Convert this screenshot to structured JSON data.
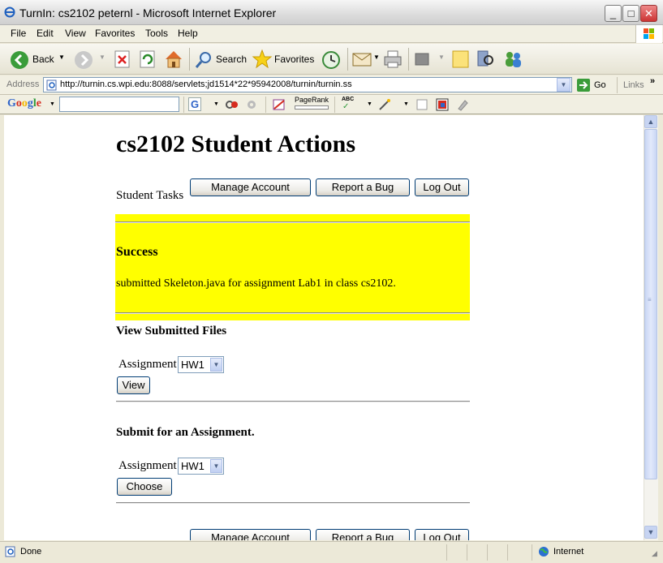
{
  "window": {
    "title": "TurnIn: cs2102 peternl - Microsoft Internet Explorer",
    "minimize": "_",
    "maximize": "□",
    "close": "✕"
  },
  "menu": [
    "File",
    "Edit",
    "View",
    "Favorites",
    "Tools",
    "Help"
  ],
  "toolbar": {
    "back": "Back",
    "search": "Search",
    "favorites": "Favorites"
  },
  "address": {
    "label": "Address",
    "url": "http://turnin.cs.wpi.edu:8088/servlets;jd1514*22*95942008/turnin/turnin.ss",
    "go": "Go",
    "links": "Links"
  },
  "google": {
    "logo": "Google",
    "g_label": "G",
    "pagerank": "PageRank",
    "abc": "ABC"
  },
  "page": {
    "heading": "cs2102 Student Actions",
    "student_tasks": "Student Tasks",
    "manage_account": "Manage Account",
    "report_bug": "Report a Bug",
    "log_out": "Log Out",
    "success_title": "Success",
    "success_message": "submitted Skeleton.java for assignment Lab1 in class cs2102.",
    "view_title": "View Submitted Files",
    "assignment_label": "Assignment",
    "view_select_value": "HW1",
    "view_button": "View",
    "submit_title": "Submit for an Assignment.",
    "submit_assignment_label": "Assignment",
    "submit_select_value": "HW1",
    "choose_button": "Choose",
    "footer_manage_account": "Manage Account",
    "footer_report_bug": "Report a Bug",
    "footer_log_out": "Log Out"
  },
  "status": {
    "text": "Done",
    "zone": "Internet"
  },
  "colors": {
    "success_bg": "#ffff00",
    "link": "#0000ff"
  }
}
